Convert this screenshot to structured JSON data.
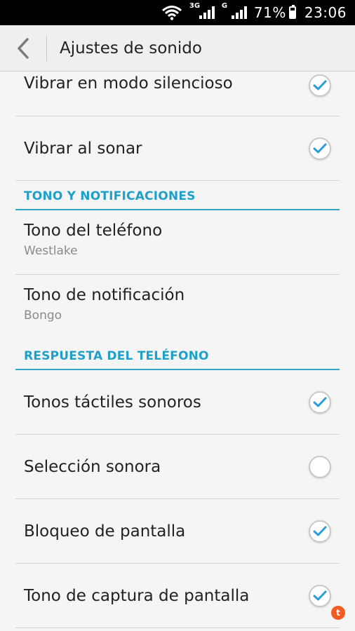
{
  "status_bar": {
    "net1_label": "3G",
    "net2_label": "G",
    "battery_text": "71%",
    "battery_level": 0.71,
    "time": "23:06"
  },
  "header": {
    "title": "Ajustes de sonido",
    "back_icon": "chevron-left-icon"
  },
  "settings": {
    "vibrate_silent": {
      "label": "Vibrar en modo silencioso",
      "checked": true
    },
    "vibrate_ring": {
      "label": "Vibrar al sonar",
      "checked": true
    },
    "section_tones": "TONO Y NOTIFICACIONES",
    "ringtone": {
      "label": "Tono del teléfono",
      "value": "Westlake"
    },
    "notification_tone": {
      "label": "Tono de notificación",
      "value": "Bongo"
    },
    "section_response": "RESPUESTA DEL TELÉFONO",
    "touch_tones": {
      "label": "Tonos táctiles sonoros",
      "checked": true
    },
    "sound_selection": {
      "label": "Selección sonora",
      "checked": false
    },
    "screen_lock": {
      "label": "Bloqueo de pantalla",
      "checked": true
    },
    "screenshot_tone": {
      "label": "Tono de captura de pantalla",
      "checked": true
    }
  },
  "overlay_badge": "t",
  "colors": {
    "accent": "#1ea0c9",
    "check": "#2a9fd6",
    "badge": "#f25c23"
  }
}
